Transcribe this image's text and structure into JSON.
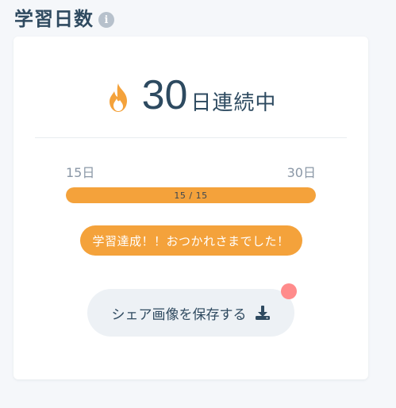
{
  "header": {
    "title": "学習日数",
    "info_icon": "info-circle-icon"
  },
  "streak": {
    "icon": "fire-icon",
    "count": "30",
    "suffix": "日連続中"
  },
  "progress": {
    "min_label": "15日",
    "max_label": "30日",
    "text": "15 / 15",
    "fraction": 1.0
  },
  "achievement": {
    "message": "学習達成！！おつかれさまでした！"
  },
  "share": {
    "button_label": "シェア画像を保存する",
    "icon": "download-icon",
    "has_notification": true
  },
  "colors": {
    "accent_orange": "#f4a23b",
    "text_dark": "#2d4a60",
    "notification_dot": "#ff8b8b",
    "button_bg": "#edf1f5"
  }
}
